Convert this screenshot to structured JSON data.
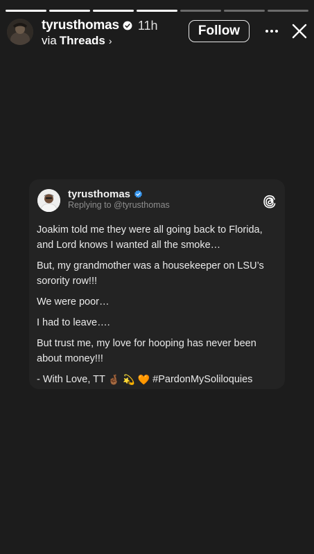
{
  "story": {
    "progress": [
      1,
      1,
      1,
      1,
      0,
      0,
      0
    ],
    "username": "tyrusthomas",
    "time": "11h",
    "via_prefix": "via",
    "via_app": "Threads",
    "chevron": "›",
    "follow_label": "Follow",
    "more_icon": "more-horizontal-icon",
    "close_icon": "close-icon"
  },
  "post": {
    "username": "tyrusthomas",
    "reply_text": "Replying to @tyrusthomas",
    "paragraphs": [
      "Joakim told me they were all going back to Florida, and Lord knows I wanted all the smoke…",
      "But, my grandmother was a housekeeper on LSU’s sorority row!!!",
      "We were poor…",
      "I had to leave….",
      "But trust me, my love for hooping has never been about money!!!"
    ],
    "signature": "- With Love, TT",
    "emojis": [
      "🤞🏾",
      "💫",
      "🧡"
    ],
    "hashtag": "#PardonMySoliloquies"
  },
  "colors": {
    "background": "#1c1c1c",
    "card": "#232323",
    "verified": "#3797f0",
    "muted_text": "#8e8e8e"
  }
}
